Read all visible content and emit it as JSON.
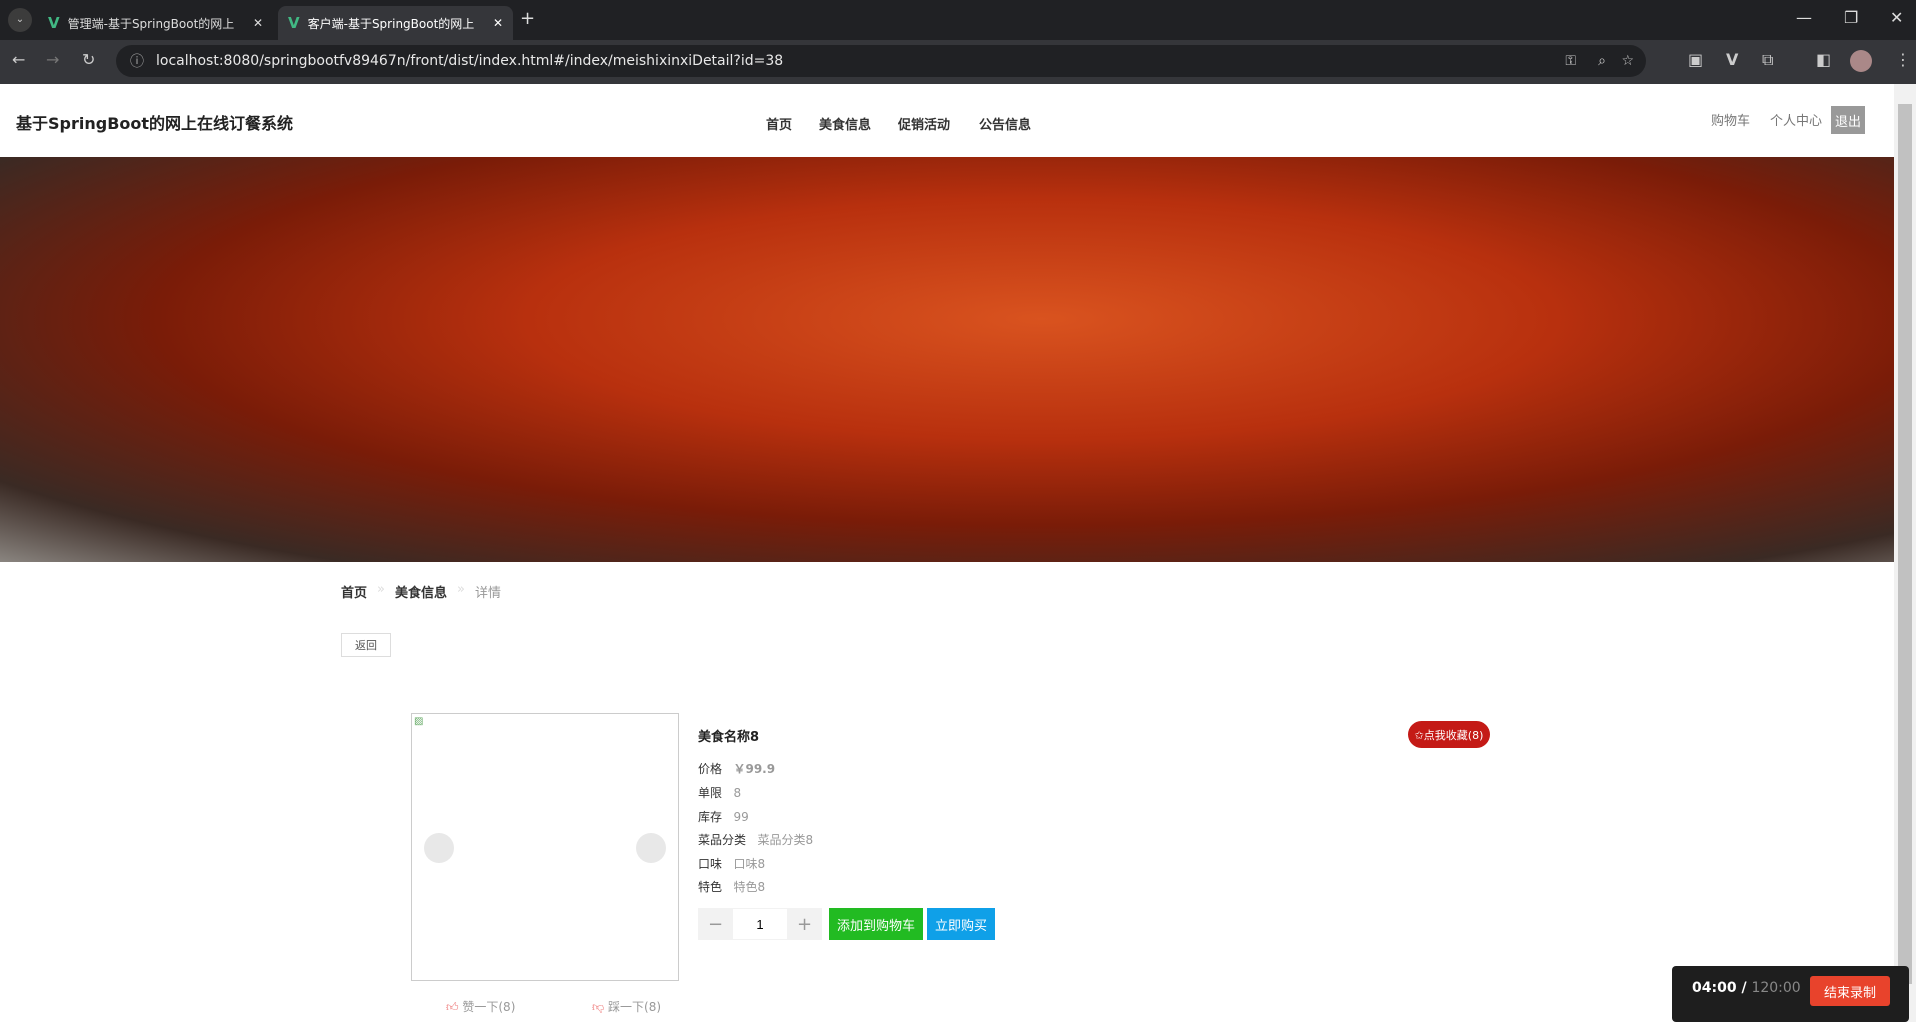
{
  "browser": {
    "tabs": [
      {
        "label": "管理端-基于SpringBoot的网上"
      },
      {
        "label": "客户端-基于SpringBoot的网上"
      }
    ],
    "url": "localhost:8080/springbootfv89467n/front/dist/index.html#/index/meishixinxiDetail?id=38"
  },
  "header": {
    "title": "基于SpringBoot的网上在线订餐系统",
    "nav": [
      "首页",
      "美食信息",
      "促销活动",
      "公告信息"
    ],
    "cart": "购物车",
    "profile": "个人中心",
    "logout": "退出"
  },
  "breadcrumb": [
    "首页",
    "美食信息",
    "详情"
  ],
  "back_label": "返回",
  "product": {
    "name": "美食名称8",
    "fields": [
      {
        "label": "价格",
        "value": "￥99.9"
      },
      {
        "label": "单限",
        "value": "8"
      },
      {
        "label": "库存",
        "value": "99"
      },
      {
        "label": "菜品分类",
        "value": "菜品分类8"
      },
      {
        "label": "口味",
        "value": "口味8"
      },
      {
        "label": "特色",
        "value": "特色8"
      }
    ],
    "quantity": "1",
    "add_cart": "添加到购物车",
    "buy_now": "立即购买",
    "favorite": "✩点我收藏(8)",
    "like": "赞一下(8)",
    "dislike": "踩一下(8)"
  },
  "colors": {
    "add_cart": "#22bb22",
    "buy_now": "#0fa0e8",
    "favorite": "#c41a16"
  },
  "recorder": {
    "elapsed": "04:00 /",
    "total": "120:00",
    "stop": "结束录制"
  }
}
